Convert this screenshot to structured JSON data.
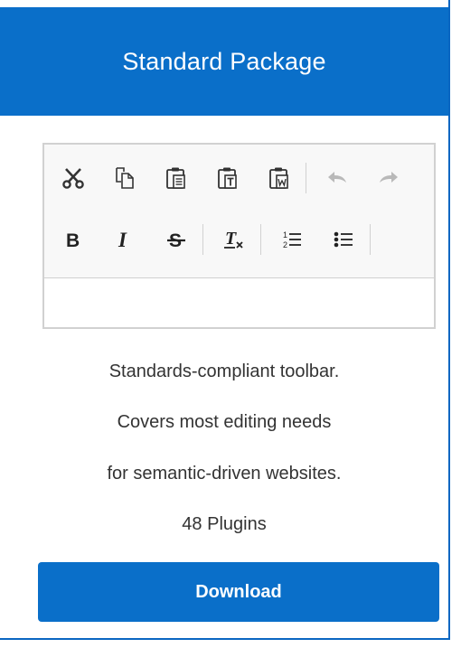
{
  "package": {
    "title": "Standard Package",
    "description_lines": [
      "Standards-compliant toolbar.",
      "Covers most editing needs",
      "for semantic-driven websites."
    ],
    "plugins": "48 Plugins",
    "download_label": "Download"
  },
  "toolbar": {
    "row1": [
      "cut-icon",
      "copy-icon",
      "paste-icon",
      "paste-text-icon",
      "paste-word-icon",
      "undo-icon",
      "redo-icon"
    ],
    "row2": [
      "bold-icon",
      "italic-icon",
      "strike-icon",
      "remove-format-icon",
      "numbered-list-icon",
      "bulleted-list-icon"
    ]
  },
  "colors": {
    "brand_blue": "#0a6fc9",
    "toolbar_bg": "#f8f8f8",
    "border": "#d1d1d1"
  }
}
